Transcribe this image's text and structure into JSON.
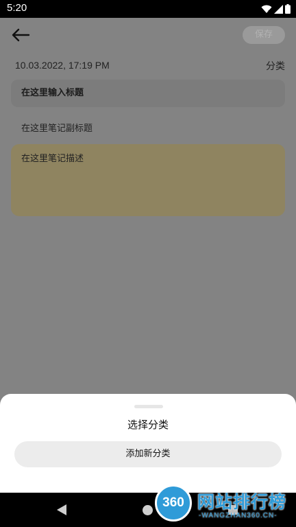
{
  "status_bar": {
    "time": "5:20",
    "icons": [
      "wifi-icon",
      "signal-icon",
      "battery-icon"
    ]
  },
  "toolbar": {
    "back_icon": "arrow-left-icon",
    "save_label": "保存"
  },
  "note": {
    "date": "10.03.2022, 17:19 PM",
    "category_label": "分类",
    "title_placeholder": "在这里输入标题",
    "subtitle_placeholder": "在这里笔记副标题",
    "description_placeholder": "在这里笔记描述"
  },
  "sheet": {
    "title": "选择分类",
    "add_button": "添加新分类"
  },
  "navigation": {
    "icons": [
      "back-triangle-icon",
      "home-circle-icon",
      "recents-square-icon"
    ]
  },
  "watermark": {
    "badge": "360",
    "text": "网站排行榜",
    "subtext": "-WANGZHAN360.CN-"
  },
  "colors": {
    "description_bg": "#8f8460",
    "watermark": "#2f9bd8",
    "sheet_bg": "#ffffff"
  }
}
